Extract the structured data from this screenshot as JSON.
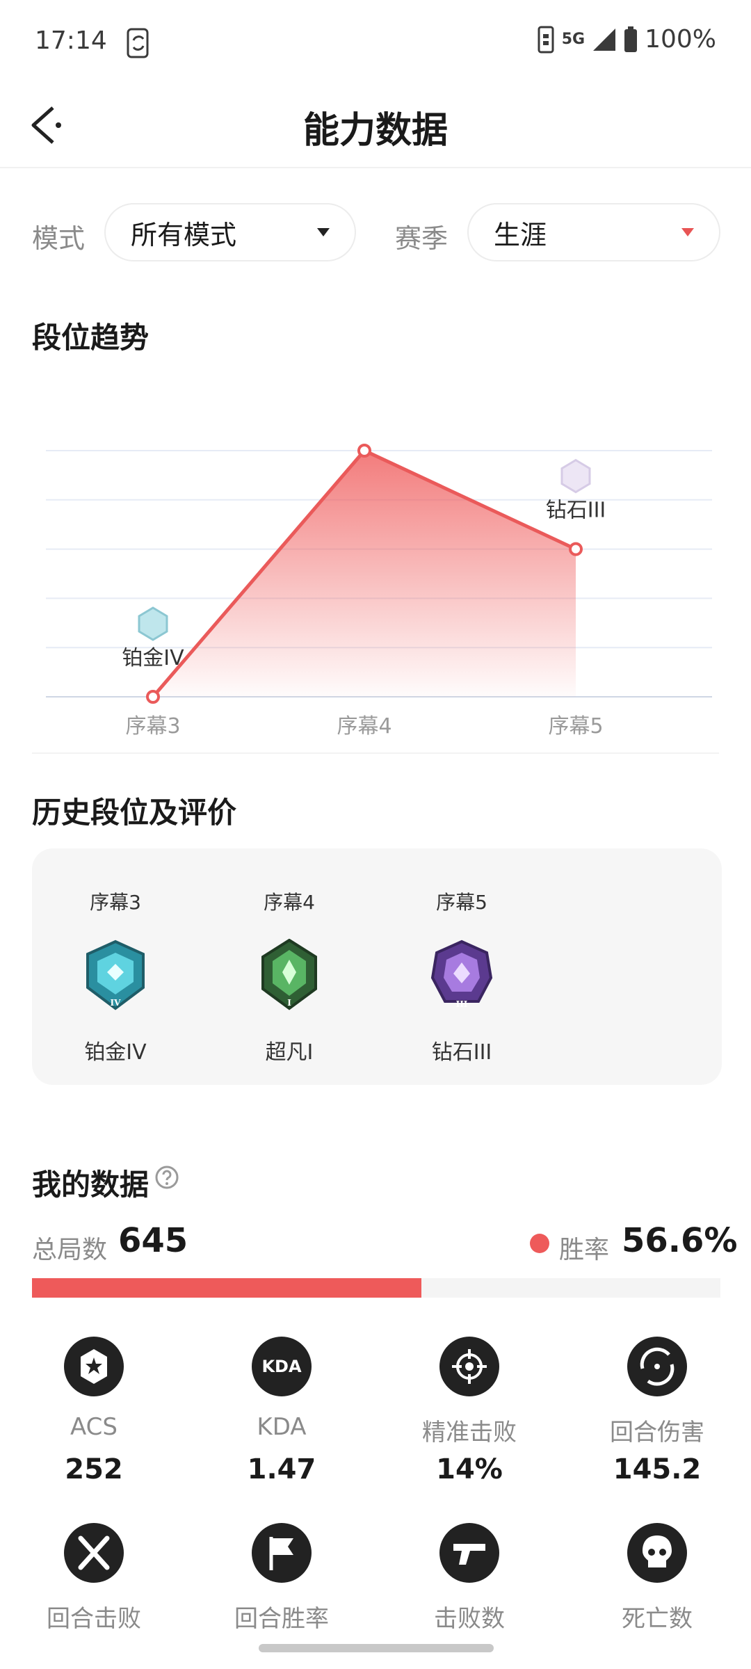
{
  "status_bar": {
    "time": "17:14",
    "network": "5G",
    "battery": "100%"
  },
  "header": {
    "title": "能力数据"
  },
  "filters": {
    "mode_label": "模式",
    "mode_value": "所有模式",
    "season_label": "赛季",
    "season_value": "生涯"
  },
  "rank_trend": {
    "title": "段位趋势",
    "chart_data": {
      "type": "area",
      "categories": [
        "序幕3",
        "序幕4",
        "序幕5"
      ],
      "values": [
        0,
        5,
        3
      ],
      "point_labels": [
        "铂金IV",
        "",
        "钻石III"
      ],
      "grid": true,
      "ylim": [
        0,
        5
      ]
    }
  },
  "history": {
    "title": "历史段位及评价",
    "items": [
      {
        "season": "序幕3",
        "rank": "铂金IV",
        "badge_color": "#2aa7b8",
        "numeral": "IV"
      },
      {
        "season": "序幕4",
        "rank": "超凡I",
        "badge_color": "#3f9c4f",
        "numeral": "I"
      },
      {
        "season": "序幕5",
        "rank": "钻石III",
        "badge_color": "#8a58c8",
        "numeral": "III"
      }
    ]
  },
  "my_data": {
    "title": "我的数据",
    "total_label": "总局数",
    "total_value": "645",
    "win_label": "胜率",
    "win_value": "56.6%",
    "win_fraction": 0.566,
    "accent_color": "#ee5a5a",
    "stats": [
      {
        "label": "ACS",
        "value": "252",
        "icon": "star-icon"
      },
      {
        "label": "KDA",
        "value": "1.47",
        "icon": "kda-icon"
      },
      {
        "label": "精准击败",
        "value": "14%",
        "icon": "crosshair-icon"
      },
      {
        "label": "回合伤害",
        "value": "145.2",
        "icon": "damage-icon"
      },
      {
        "label": "回合击败",
        "value": "",
        "icon": "crossed-blades-icon"
      },
      {
        "label": "回合胜率",
        "value": "",
        "icon": "flag-icon"
      },
      {
        "label": "击败数",
        "value": "",
        "icon": "gun-icon"
      },
      {
        "label": "死亡数",
        "value": "",
        "icon": "skull-icon"
      }
    ]
  }
}
